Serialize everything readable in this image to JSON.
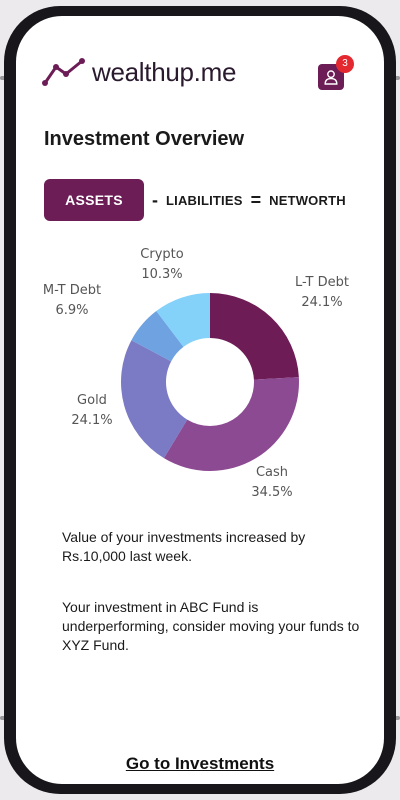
{
  "app": {
    "logo_text": "wealthup.me",
    "notification_count": "3"
  },
  "page_title": "Investment Overview",
  "equation": {
    "assets_label": "ASSETS",
    "minus": "-",
    "liabilities_label": "LIABILITIES",
    "equals": "=",
    "networth_label": "NETWORTH"
  },
  "chart_data": {
    "type": "pie",
    "donut": true,
    "categories": [
      "L-T Debt",
      "Cash",
      "Gold",
      "M-T Debt",
      "Crypto"
    ],
    "values": [
      24.1,
      34.5,
      24.1,
      6.9,
      10.3
    ],
    "value_labels": [
      "24.1%",
      "34.5%",
      "24.1%",
      "6.9%",
      "10.3%"
    ],
    "colors": [
      "#6d1c55",
      "#8c4a92",
      "#7b7ac5",
      "#6ea2e0",
      "#84d1fa"
    ]
  },
  "insights": [
    "Value of your investments increased by Rs.10,000 last week.",
    "Your investment in ABC Fund is underperforming, consider moving your funds to XYZ Fund."
  ],
  "cta_label": "Go to Investments",
  "colors": {
    "brand": "#6c1d56",
    "badge": "#e3282f"
  }
}
